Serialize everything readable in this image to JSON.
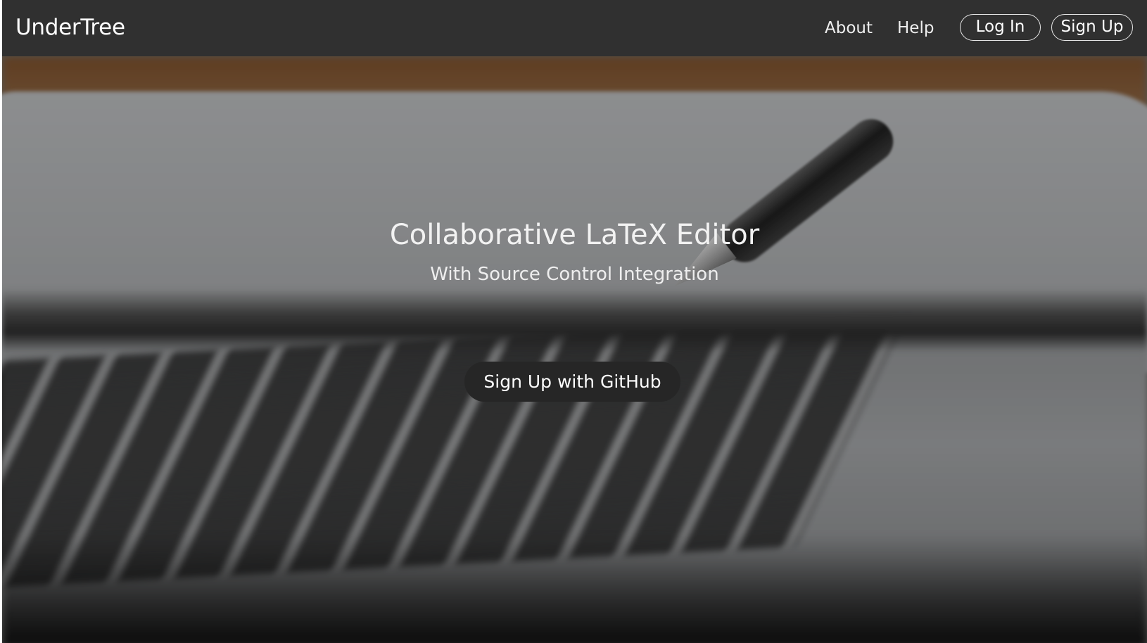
{
  "navbar": {
    "brand": "UnderTree",
    "links": [
      {
        "label": "About"
      },
      {
        "label": "Help"
      }
    ],
    "login_label": "Log In",
    "signup_label": "Sign Up",
    "background_color": "#303030"
  },
  "hero": {
    "title": "Collaborative LaTeX Editor",
    "subtitle": "With Source Control Integration",
    "cta_label": "Sign Up with GitHub",
    "cta_color": "#262626"
  }
}
